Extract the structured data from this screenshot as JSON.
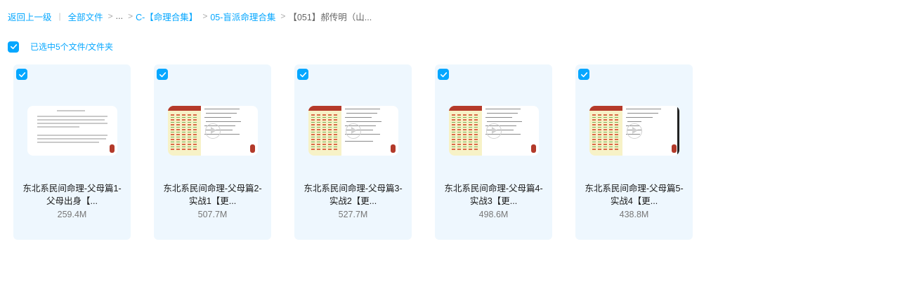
{
  "breadcrumb": {
    "back": "返回上一级",
    "items": [
      "全部文件",
      "...",
      "C-【命理合集】",
      "05-盲派命理合集"
    ],
    "current": "【051】郝传明（山..."
  },
  "selection": {
    "text": "已选中5个文件/文件夹",
    "checked": true
  },
  "files": [
    {
      "name_line1": "东北系民间命理-父母篇1-",
      "name_line2": "父母出身【...",
      "size": "259.4M",
      "thumb": "document"
    },
    {
      "name_line1": "东北系民间命理-父母篇2-",
      "name_line2": "实战1【更...",
      "size": "507.7M",
      "thumb": "video"
    },
    {
      "name_line1": "东北系民间命理-父母篇3-",
      "name_line2": "实战2【更...",
      "size": "527.7M",
      "thumb": "video"
    },
    {
      "name_line1": "东北系民间命理-父母篇4-",
      "name_line2": "实战3【更...",
      "size": "498.6M",
      "thumb": "video"
    },
    {
      "name_line1": "东北系民间命理-父母篇5-",
      "name_line2": "实战4【更...",
      "size": "438.8M",
      "thumb": "video"
    }
  ],
  "colors": {
    "accent": "#06a7ff",
    "card_bg": "#eef7fe"
  }
}
